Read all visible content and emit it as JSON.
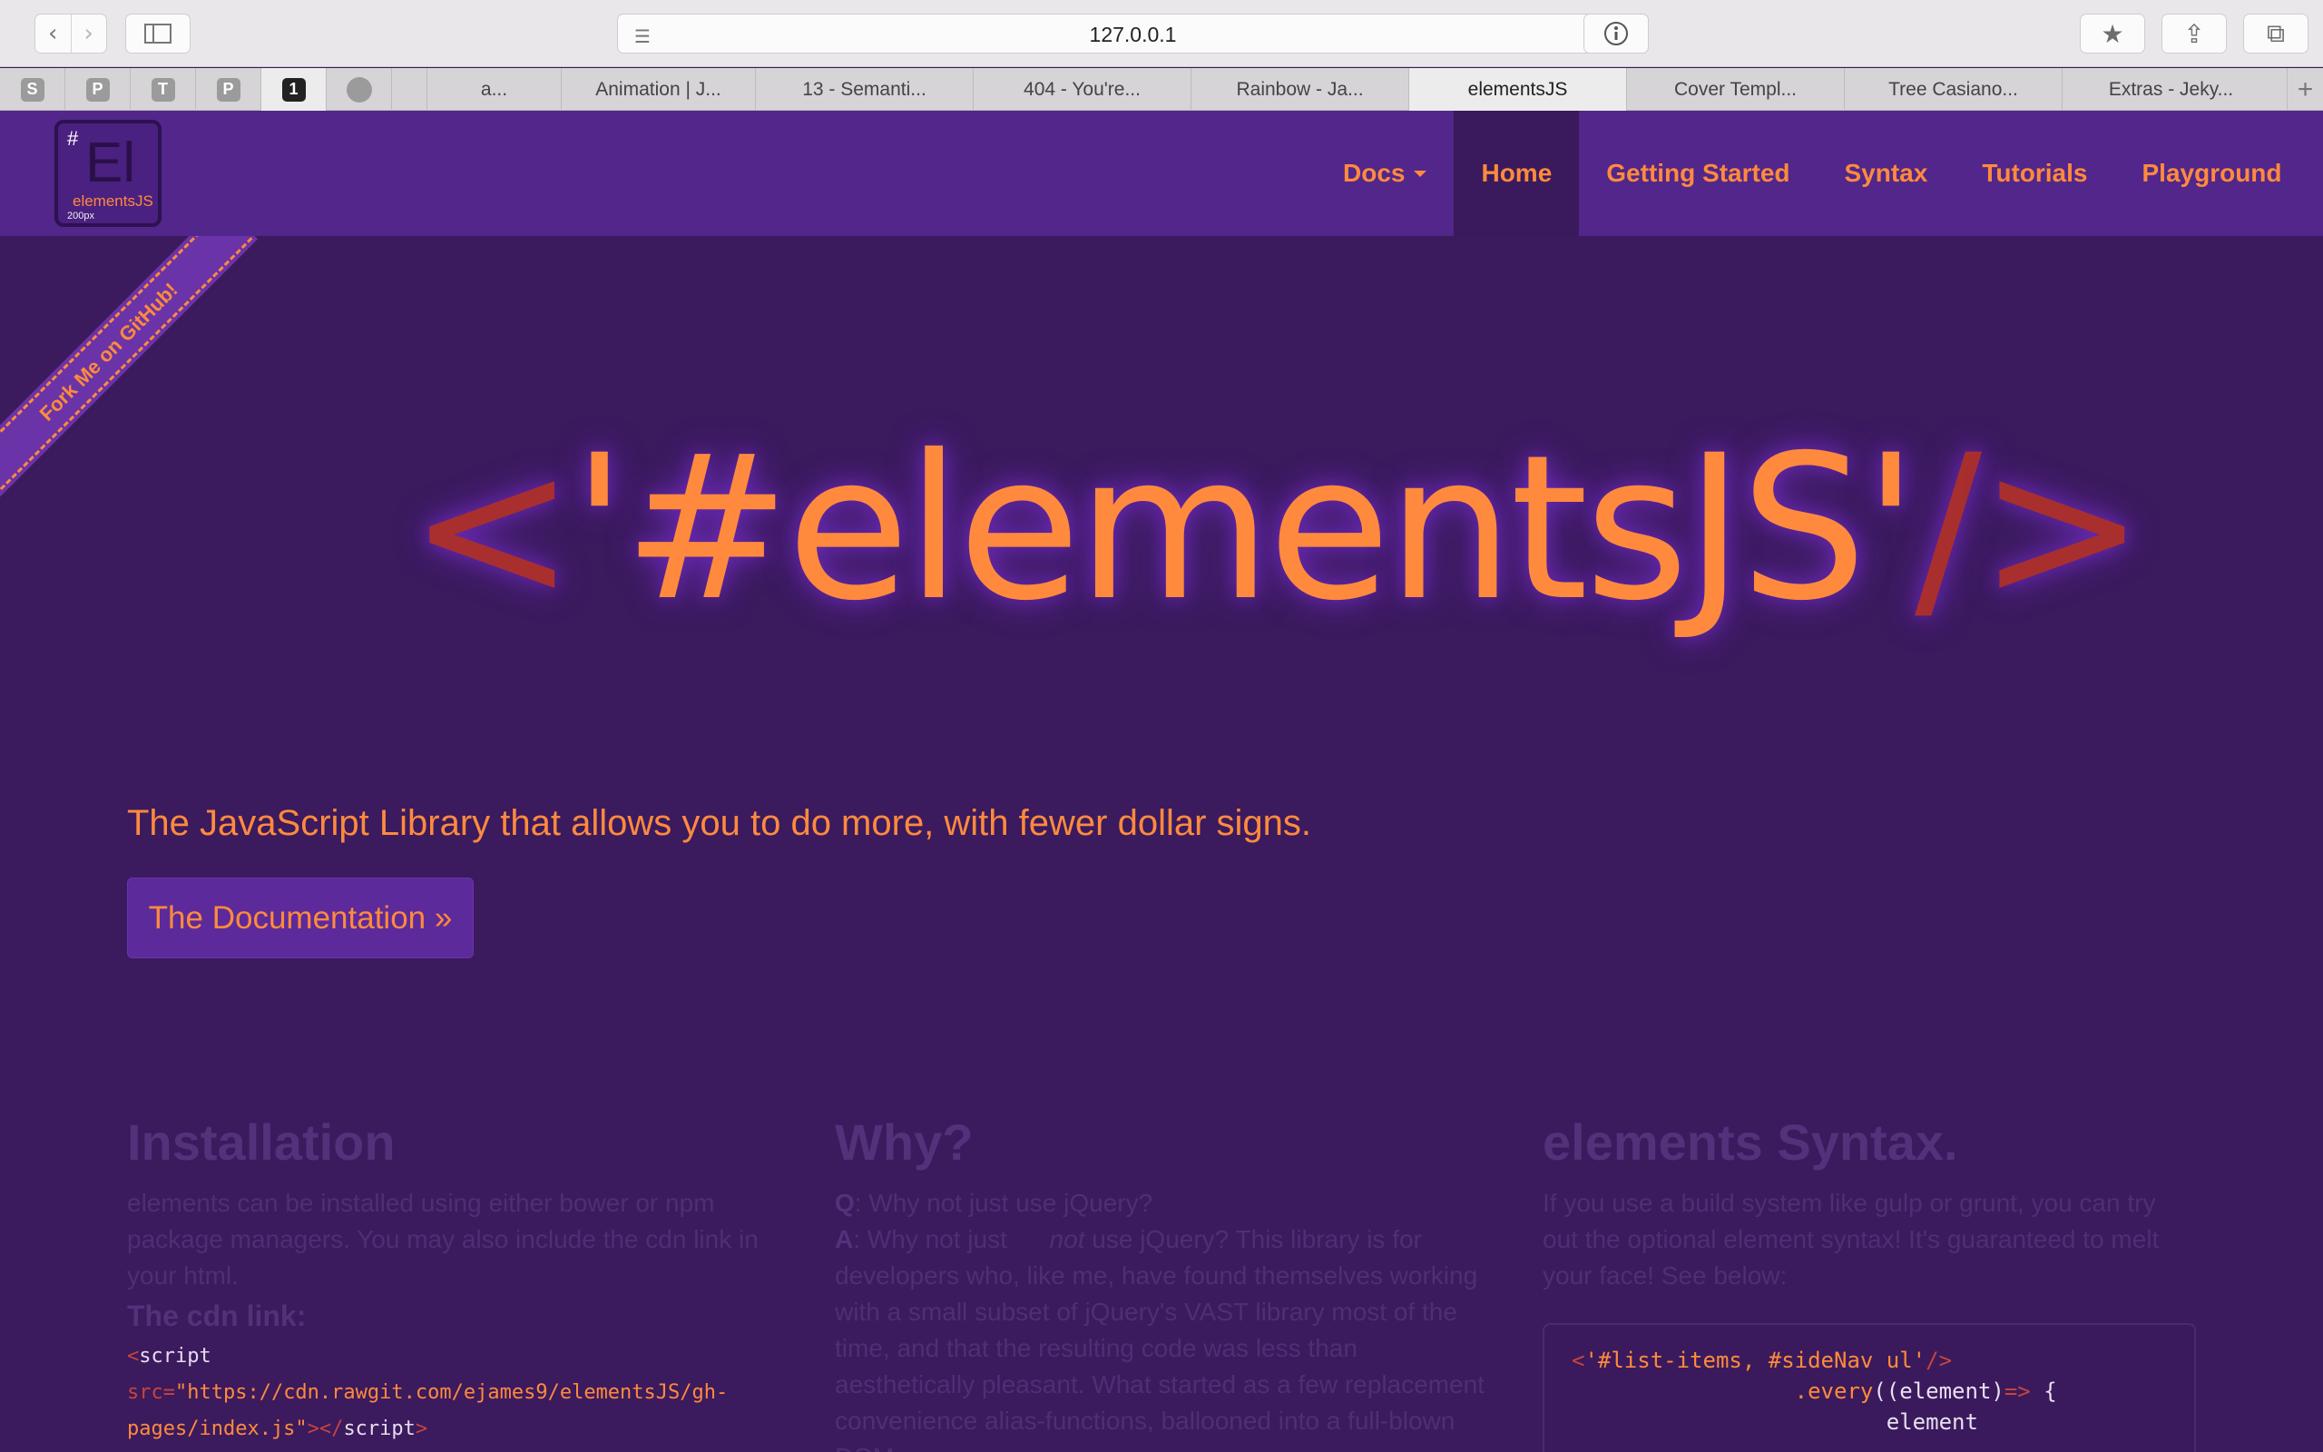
{
  "browser": {
    "url": "127.0.0.1",
    "pinned_tabs": [
      "S",
      "P",
      "T",
      "P",
      "1",
      "github"
    ],
    "tabs": [
      "a...",
      "Animation | J...",
      "13 - Semanti...",
      "404 - You're...",
      "Rainbow - Ja...",
      "elementsJS",
      "Cover Templ...",
      "Tree Casiano...",
      "Extras - Jeky..."
    ],
    "active_tab": "elementsJS"
  },
  "site": {
    "logo": {
      "hash": "#",
      "symbol": "El",
      "name": "elementsJS",
      "size": "200px"
    },
    "nav": [
      {
        "label": "Docs",
        "dropdown": true,
        "active": false
      },
      {
        "label": "Home",
        "dropdown": false,
        "active": true
      },
      {
        "label": "Getting Started",
        "dropdown": false,
        "active": false
      },
      {
        "label": "Syntax",
        "dropdown": false,
        "active": false
      },
      {
        "label": "Tutorials",
        "dropdown": false,
        "active": false
      },
      {
        "label": "Playground",
        "dropdown": false,
        "active": false
      }
    ],
    "ribbon": "Fork Me on GitHub!",
    "hero": {
      "open": "<",
      "title": "'#elementsJS'",
      "slash": "/",
      "close": ">"
    },
    "tagline": "The JavaScript Library that allows you to do more, with fewer dollar signs.",
    "doc_button": "The Documentation »",
    "installation": {
      "title": "Installation",
      "body": "elements can be installed using either bower or npm package managers. You may also include the cdn link in your html.",
      "cdn_title": "The cdn link:",
      "cdn_tag_open": "<",
      "cdn_script": "script",
      "cdn_attr": "src=",
      "cdn_url": "\"https://cdn.rawgit.com/ejames9/elementsJS/gh-pages/index.js\"",
      "cdn_close": "></",
      "cdn_script_end": "script",
      "cdn_gt": ">"
    },
    "why": {
      "title": "Why?",
      "q_label": "Q",
      "q_text": ": Why not just use jQuery?",
      "a_label": "A",
      "a_text_1": ": Why not just",
      "a_not": "not",
      "a_text_2": "use jQuery? This library is for developers who, like me, have found themselves working with a small subset of jQuery's VAST library most of the time, and that the resulting code was less than aesthetically pleasant. What started as a few replacement convenience alias-functions, ballooned into a full-blown DOM"
    },
    "syntax": {
      "title": "elements Syntax.",
      "body": "If you use a build system like gulp or grunt, you can try out the optional element syntax! It's guaranteed to melt your face! See below:",
      "code_line1_open": "<",
      "code_line1_str": "'#list-items, #sideNav ul'",
      "code_line1_close": "/>",
      "code_line2_fn": ".every",
      "code_line2_rest": "((element)",
      "code_line2_arrow": "=>",
      "code_line2_brace": " {",
      "code_line3": "element"
    }
  },
  "colors": {
    "bg": "#3b1a5e",
    "nav": "#52268a",
    "accent": "#ff8a3d",
    "bracket": "#a82f2e"
  }
}
